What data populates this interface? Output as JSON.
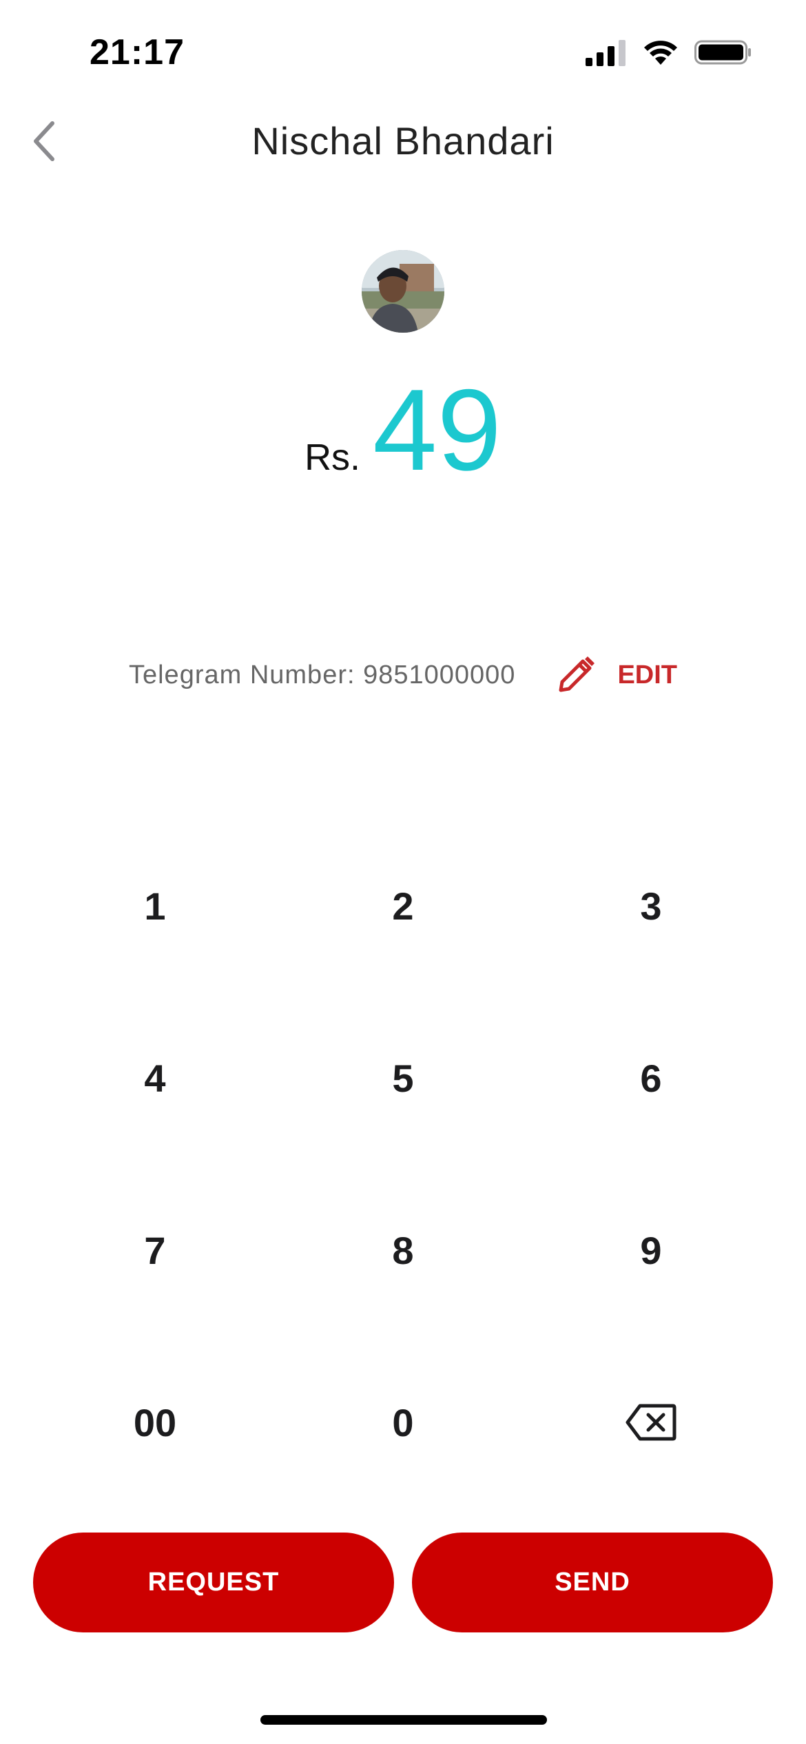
{
  "status_bar": {
    "time": "21:17",
    "icons": [
      "cellular-signal-icon",
      "wifi-icon",
      "battery-icon"
    ]
  },
  "header": {
    "back_icon": "chevron-left-icon",
    "title": "Nischal Bhandari"
  },
  "payment": {
    "currency": "Rs.",
    "amount": "49",
    "amount_color": "#1cc8cf"
  },
  "recipient": {
    "number_text": "Telegram Number: 9851000000",
    "edit_icon": "pencil-icon",
    "edit_label": "EDIT"
  },
  "keypad": {
    "rows": [
      [
        "1",
        "2",
        "3"
      ],
      [
        "4",
        "5",
        "6"
      ],
      [
        "7",
        "8",
        "9"
      ],
      [
        "00",
        "0",
        "backspace-icon"
      ]
    ]
  },
  "actions": {
    "request_label": "REQUEST",
    "send_label": "SEND",
    "button_color": "#cc0000"
  },
  "colors": {
    "accent": "#1cc8cf",
    "brand_red": "#cc0000",
    "edit_red": "#c8282a"
  }
}
